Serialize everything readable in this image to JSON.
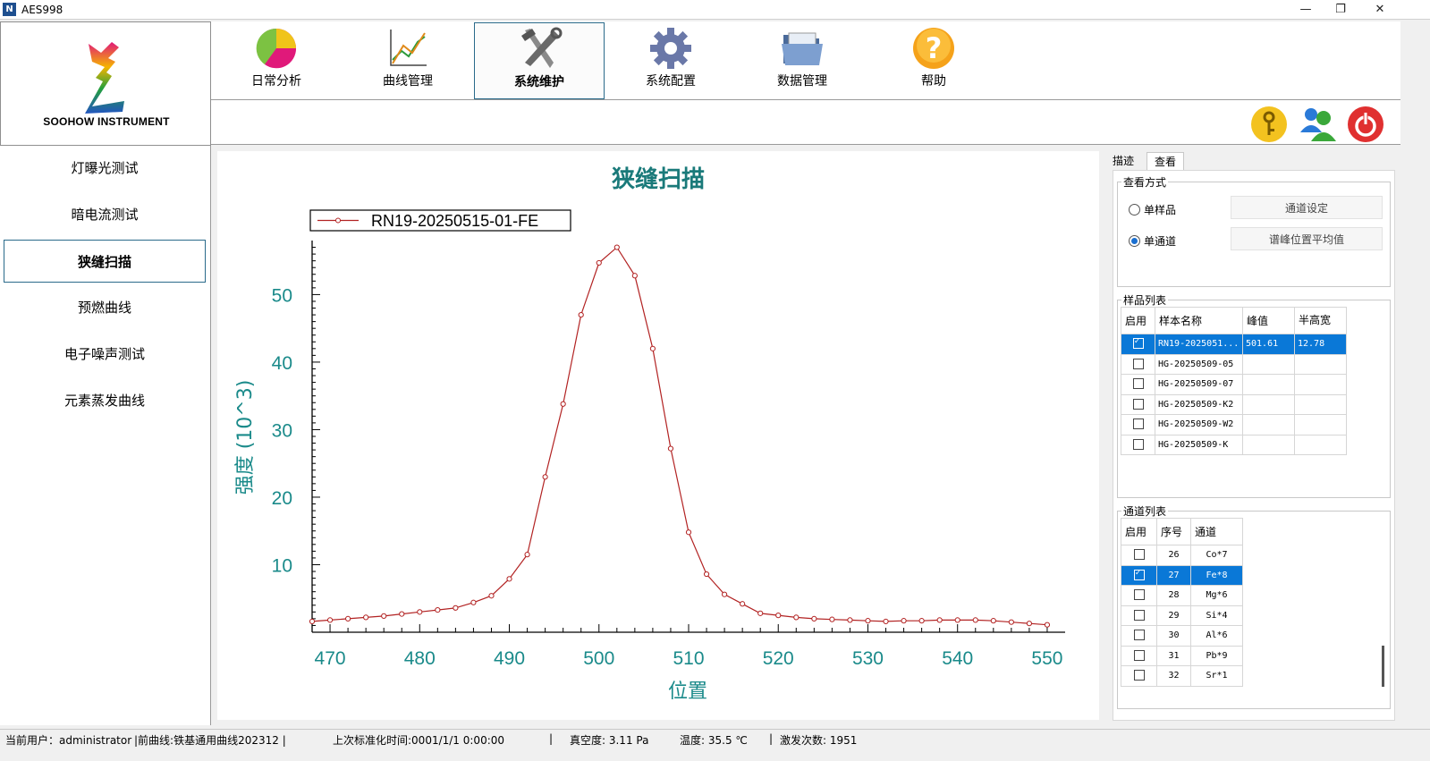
{
  "window": {
    "title": "AES998",
    "minimize": "—",
    "restore": "❐",
    "close": "✕"
  },
  "logo": {
    "text": "SOOHOW INSTRUMENT"
  },
  "toolbar": [
    {
      "label": "日常分析",
      "icon": "pie-chart-icon"
    },
    {
      "label": "曲线管理",
      "icon": "line-chart-icon"
    },
    {
      "label": "系统维护",
      "icon": "wrench-hammer-icon",
      "active": true
    },
    {
      "label": "系统配置",
      "icon": "gear-icon"
    },
    {
      "label": "数据管理",
      "icon": "folder-icon"
    },
    {
      "label": "帮助",
      "icon": "help-icon"
    }
  ],
  "subbar": {
    "icons": [
      "key-icon",
      "users-icon",
      "power-icon"
    ]
  },
  "sidebar": {
    "items": [
      "灯曝光测试",
      "暗电流测试",
      "狭缝扫描",
      "预燃曲线",
      "电子噪声测试",
      "元素蒸发曲线"
    ],
    "active_index": 2
  },
  "chart_data": {
    "type": "line",
    "title": "狭缝扫描",
    "xlabel": "位置",
    "ylabel": "强度 (10^3)",
    "xlim": [
      468,
      552
    ],
    "ylim": [
      0,
      58
    ],
    "xticks": [
      470,
      480,
      490,
      500,
      510,
      520,
      530,
      540,
      550
    ],
    "yticks": [
      10,
      20,
      30,
      40,
      50
    ],
    "legend_position": "top-left",
    "color": "#b22222",
    "series": [
      {
        "name": "RN19-20250515-01-FE",
        "x": [
          468,
          470,
          472,
          474,
          476,
          478,
          480,
          482,
          484,
          486,
          488,
          490,
          492,
          494,
          496,
          498,
          500,
          502,
          504,
          506,
          508,
          510,
          512,
          514,
          516,
          518,
          520,
          522,
          524,
          526,
          528,
          530,
          532,
          534,
          536,
          538,
          540,
          542,
          544,
          546,
          548,
          550
        ],
        "y": [
          1.6,
          1.8,
          2.0,
          2.2,
          2.4,
          2.7,
          3.0,
          3.3,
          3.6,
          4.4,
          5.4,
          7.9,
          11.5,
          23.0,
          33.8,
          47.0,
          54.7,
          57.0,
          52.8,
          42.0,
          27.2,
          14.8,
          8.6,
          5.6,
          4.2,
          2.8,
          2.5,
          2.2,
          2.0,
          1.9,
          1.8,
          1.7,
          1.6,
          1.7,
          1.7,
          1.8,
          1.8,
          1.8,
          1.7,
          1.5,
          1.3,
          1.1
        ]
      }
    ]
  },
  "right": {
    "tabs": [
      "描迹",
      "查看"
    ],
    "active_tab": 1,
    "view_group": {
      "title": "查看方式",
      "radio_single_sample": "单样品",
      "radio_single_channel": "单通道",
      "btn_channel_setting": "通道设定",
      "btn_peak_avg": "谱峰位置平均值"
    },
    "sample_group": {
      "title": "样品列表",
      "headers": [
        "启用",
        "样本名称",
        "峰值",
        "半高宽"
      ],
      "rows": [
        {
          "checked": true,
          "name": "RN19-2025051...",
          "peak": "501.61",
          "fwhm": "12.78",
          "selected": true
        },
        {
          "checked": false,
          "name": "HG-20250509-05",
          "peak": "",
          "fwhm": ""
        },
        {
          "checked": false,
          "name": "HG-20250509-07",
          "peak": "",
          "fwhm": ""
        },
        {
          "checked": false,
          "name": "HG-20250509-K2",
          "peak": "",
          "fwhm": ""
        },
        {
          "checked": false,
          "name": "HG-20250509-W2",
          "peak": "",
          "fwhm": ""
        },
        {
          "checked": false,
          "name": "HG-20250509-K",
          "peak": "",
          "fwhm": ""
        }
      ]
    },
    "channel_group": {
      "title": "通道列表",
      "headers": [
        "启用",
        "序号",
        "通道"
      ],
      "rows": [
        {
          "checked": false,
          "no": "26",
          "ch": "Co*7"
        },
        {
          "checked": true,
          "no": "27",
          "ch": "Fe*8",
          "selected": true
        },
        {
          "checked": false,
          "no": "28",
          "ch": "Mg*6"
        },
        {
          "checked": false,
          "no": "29",
          "ch": "Si*4"
        },
        {
          "checked": false,
          "no": "30",
          "ch": "Al*6"
        },
        {
          "checked": false,
          "no": "31",
          "ch": "Pb*9"
        },
        {
          "checked": false,
          "no": "32",
          "ch": "Sr*1"
        }
      ]
    }
  },
  "status": {
    "user": "当前用户：administrator",
    "curve": "|前曲线:铁基通用曲线202312 |",
    "calib": "上次标准化时间:0001/1/1 0:00:00",
    "sep1": "|",
    "vacuum": "真空度: 3.11 Pa",
    "temp": "温度: 35.5 ℃",
    "sep2": "|",
    "count": "激发次数:  1951"
  }
}
